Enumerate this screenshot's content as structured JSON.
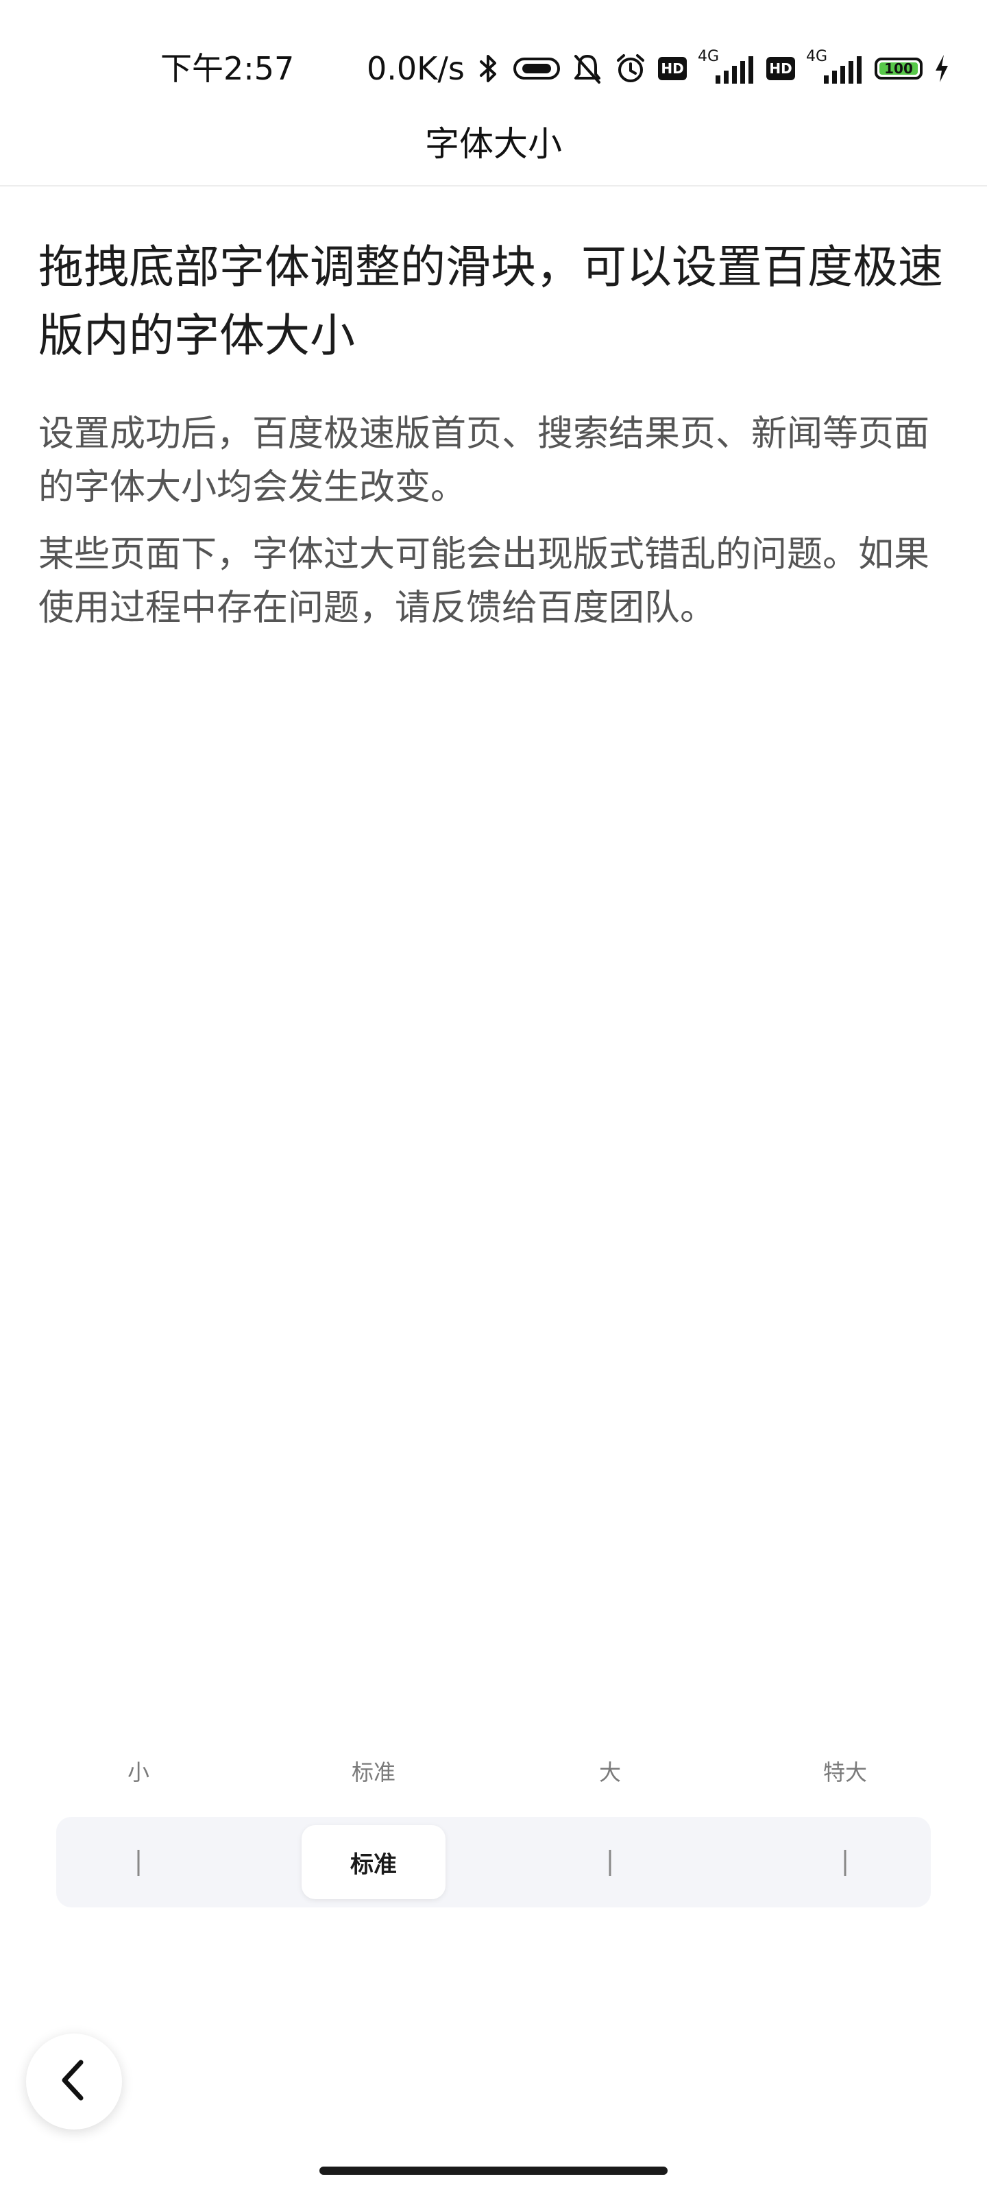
{
  "status_bar": {
    "time": "下午2:57",
    "net_speed": "0.0K/s",
    "hd_badge": "HD",
    "network_type": "4G",
    "battery": "100",
    "icons": [
      "bluetooth-icon",
      "video-icon",
      "mute-bell-icon",
      "alarm-icon",
      "hd-icon",
      "signal-icon",
      "hd-icon",
      "signal-icon",
      "battery-icon",
      "charging-icon"
    ],
    "battery_color": "#58c84a"
  },
  "header": {
    "title": "字体大小"
  },
  "content": {
    "headline": "拖拽底部字体调整的滑块，可以设置百度极速版内的字体大小",
    "paragraph_1": "设置成功后，百度极速版首页、搜索结果页、新闻等页面的字体大小均会发生改变。",
    "paragraph_2": "某些页面下，字体过大可能会出现版式错乱的问题。如果使用过程中存在问题，请反馈给百度团队。"
  },
  "font_slider": {
    "options": [
      "小",
      "标准",
      "大",
      "特大"
    ],
    "selected": "标准",
    "selected_index": 1,
    "track_color": "#f4f5f9"
  },
  "back_button": {
    "icon": "chevron-left-icon"
  }
}
